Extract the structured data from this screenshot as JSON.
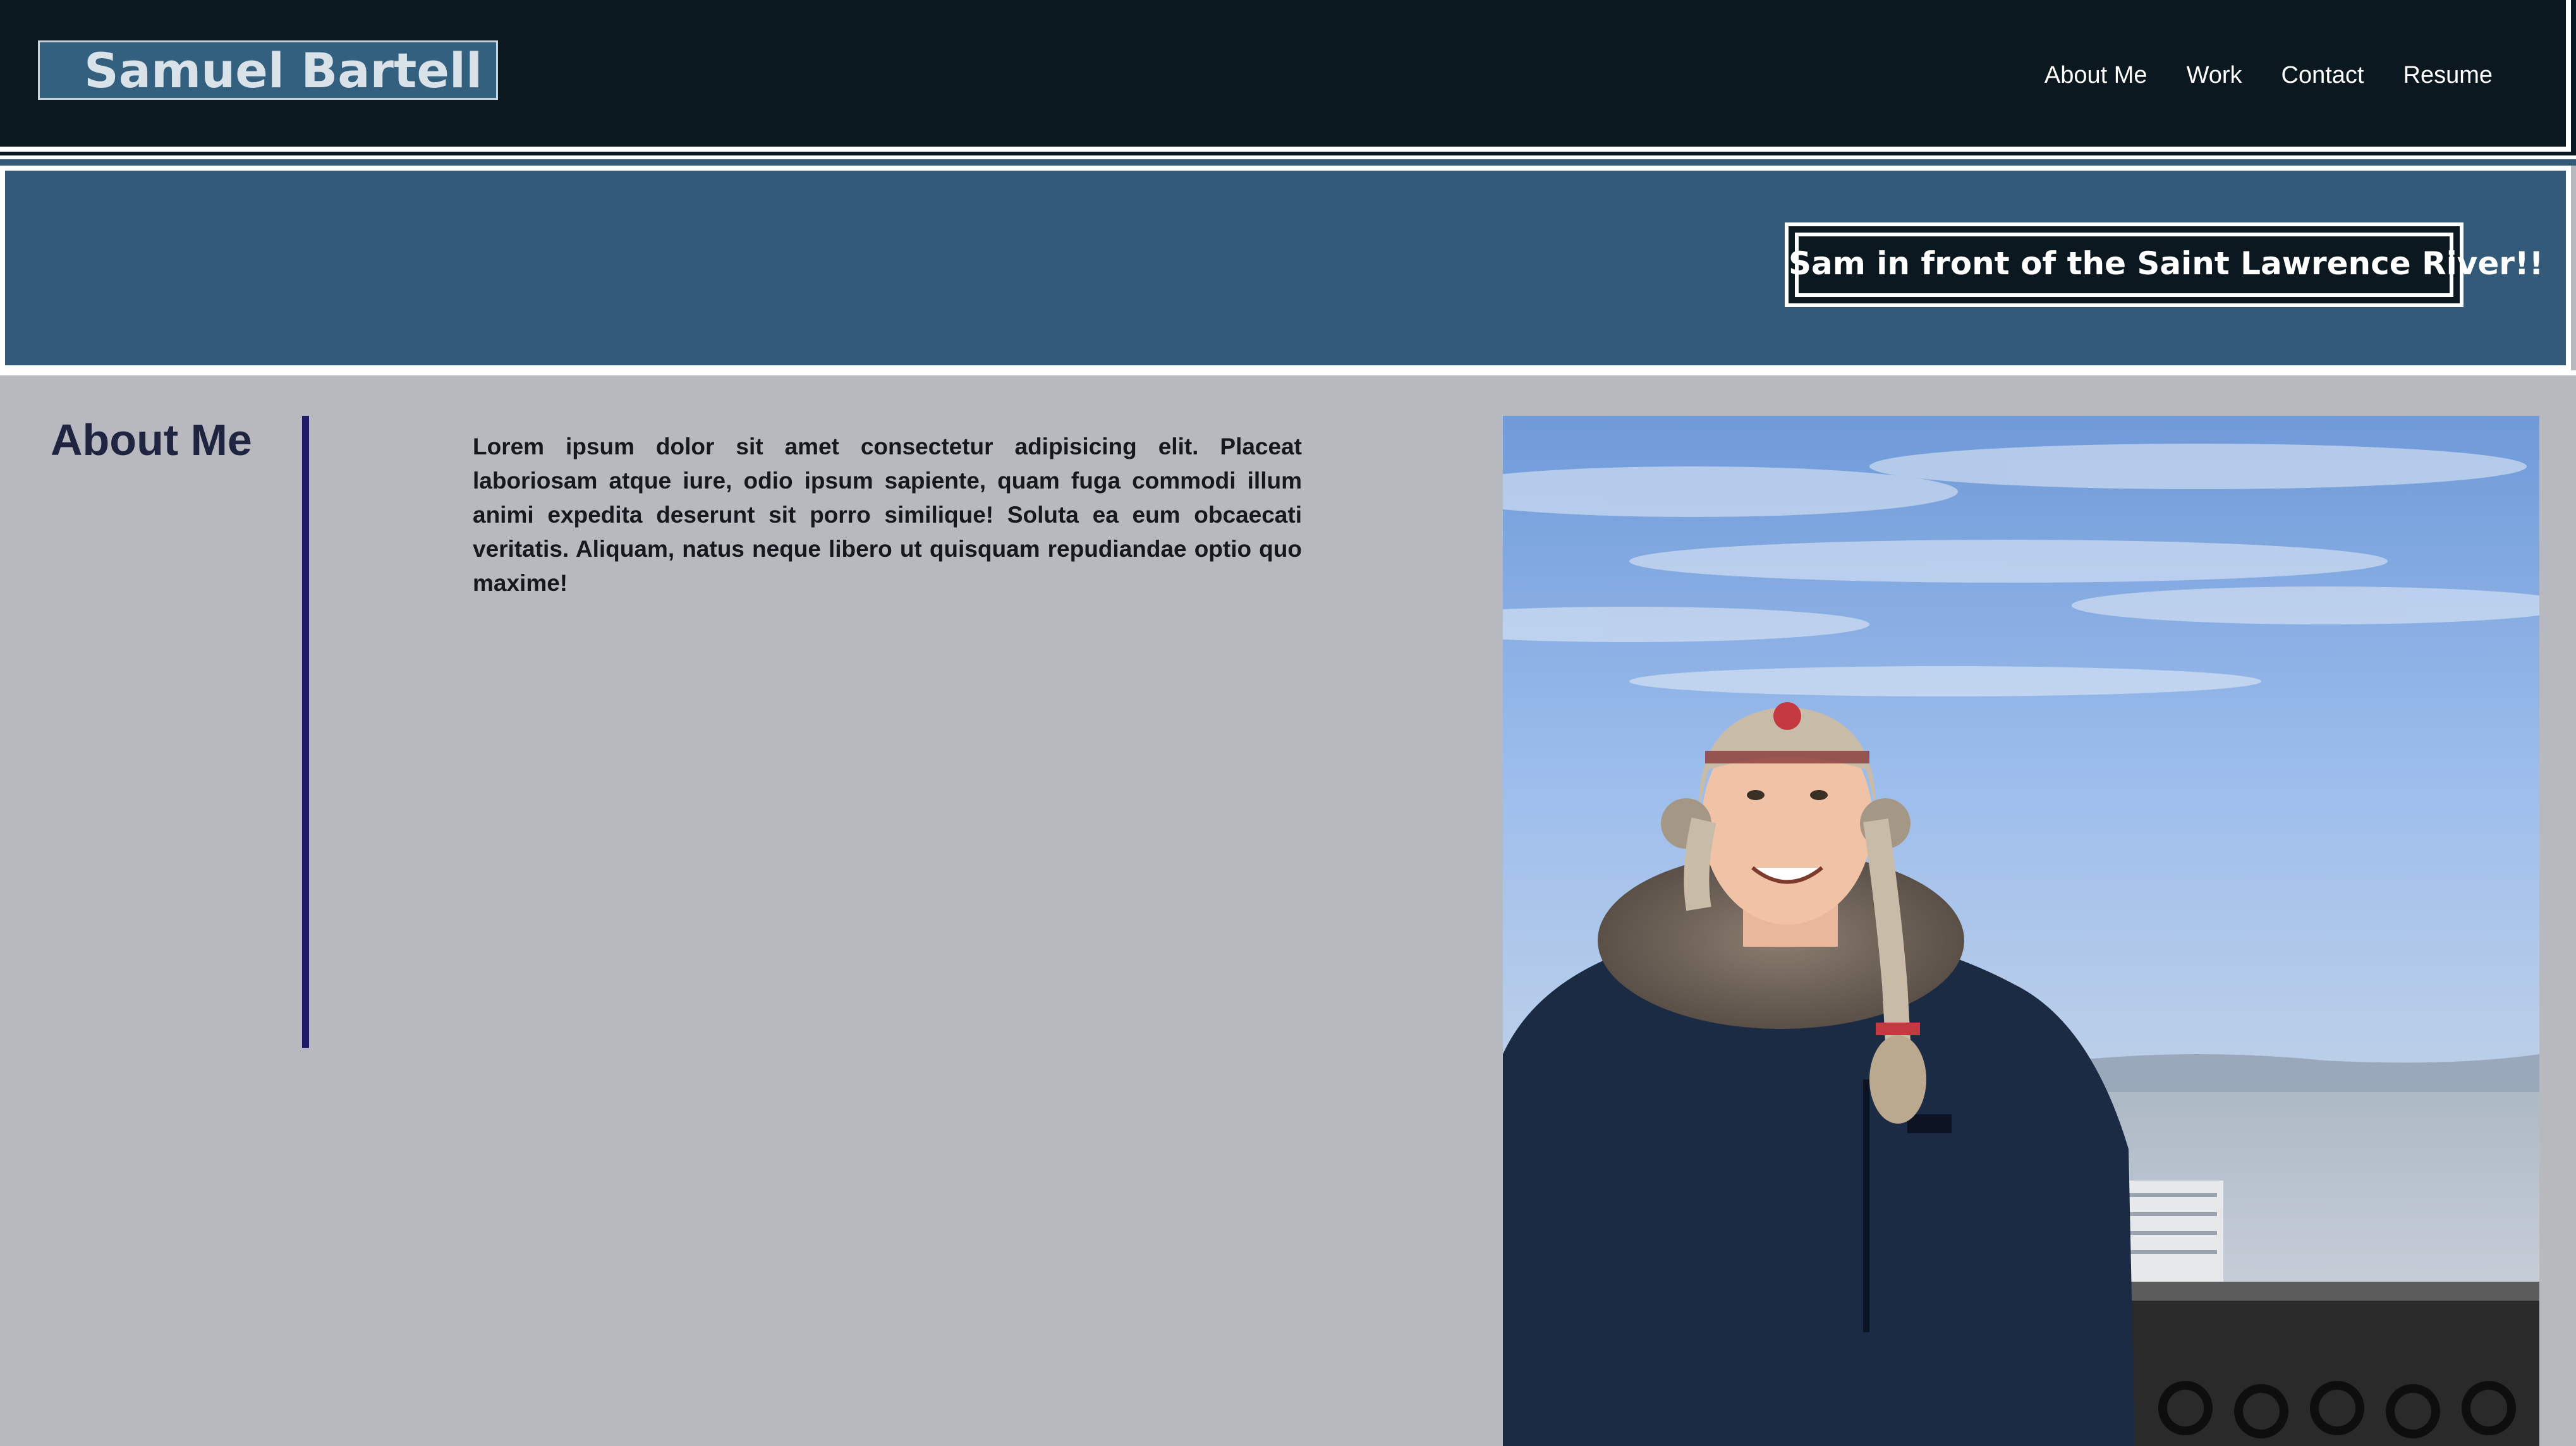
{
  "header": {
    "logo_text": "Samuel Bartell",
    "nav": [
      {
        "label": "About Me"
      },
      {
        "label": "Work"
      },
      {
        "label": "Contact"
      },
      {
        "label": "Resume"
      }
    ]
  },
  "banner": {
    "caption": "Sam in front of the Saint Lawrence River!!"
  },
  "about": {
    "heading": "About Me",
    "body": "Lorem ipsum dolor sit amet consectetur adipisicing elit. Placeat laboriosam atque iure, odio ipsum sapiente, quam fuga commodi illum animi expedita deserunt sit porro similique! Soluta ea eum obcaecati veritatis. Aliquam, natus neque libero ut quisquam repudiandae optio quo maxime!"
  },
  "colors": {
    "header_bg": "#0b1820",
    "banner_bg": "#335b79",
    "page_bg": "#b7b9bf",
    "logo_bg": "#34607f",
    "divider": "#1f1a66"
  }
}
